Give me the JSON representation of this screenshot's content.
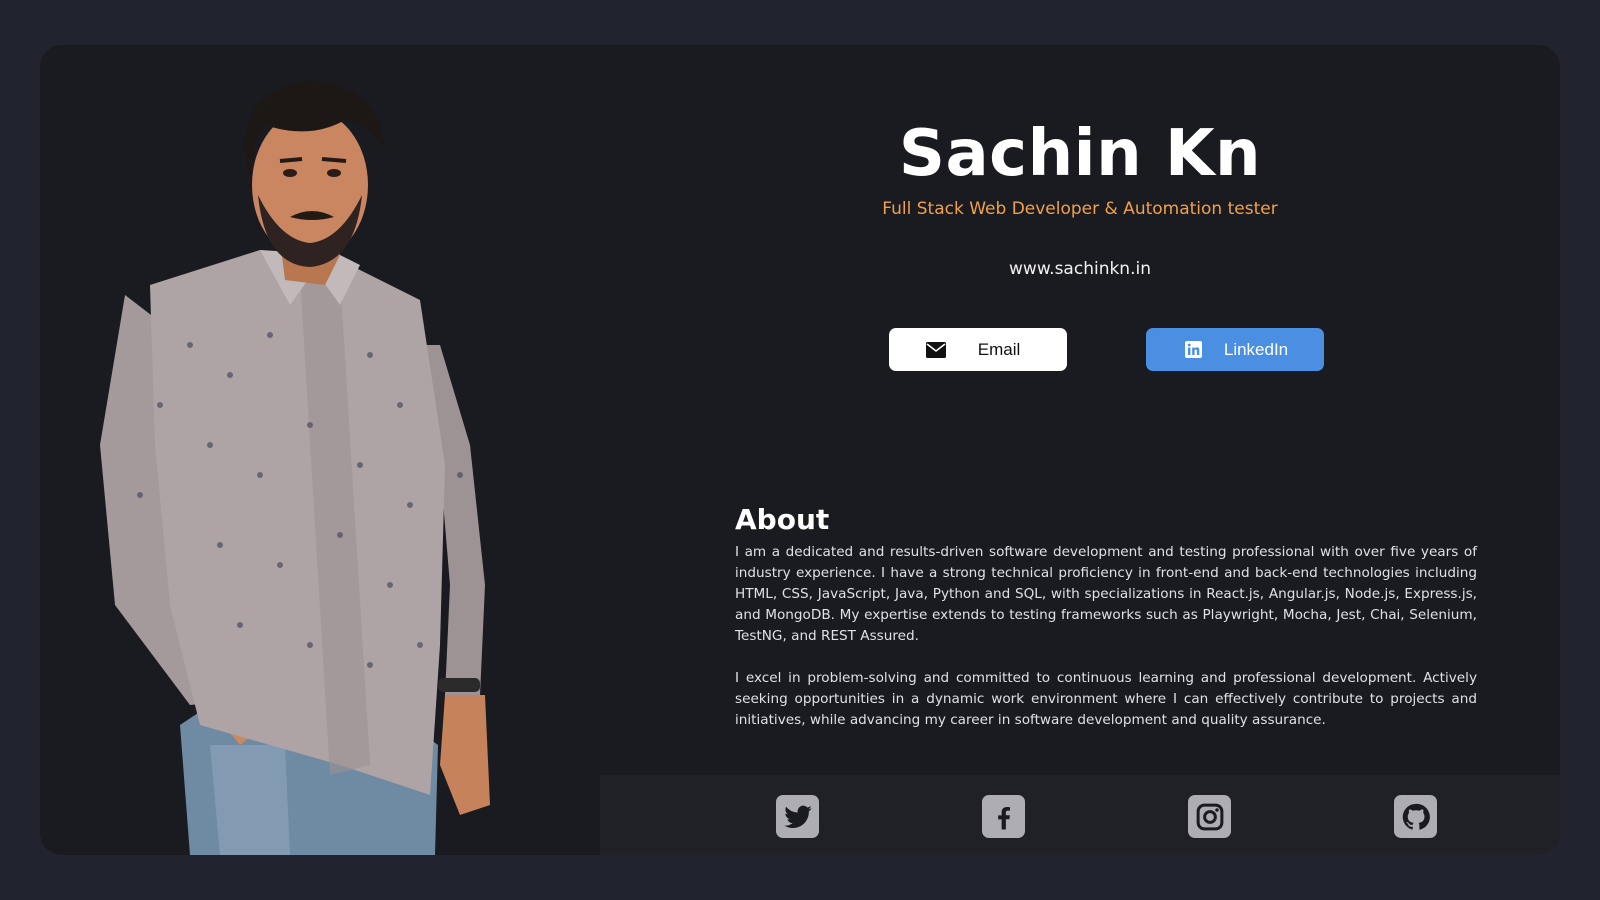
{
  "profile": {
    "name": "Sachin Kn",
    "subtitle": "Full Stack Web Developer & Automation tester",
    "website": "www.sachinkn.in"
  },
  "buttons": {
    "email": {
      "label": "Email",
      "icon": "envelope-icon"
    },
    "linkedin": {
      "label": "LinkedIn",
      "icon": "linkedin-icon"
    }
  },
  "about": {
    "heading": "About",
    "paragraphs": [
      "I am a dedicated and results-driven software development and testing professional with over five years of industry experience. I have a strong technical proficiency in front-end and back-end technologies including HTML, CSS, JavaScript, Java, Python and SQL, with specializations in React.js, Angular.js, Node.js, Express.js, and MongoDB. My expertise extends to testing frameworks such as Playwright, Mocha, Jest, Chai, Selenium, TestNG, and REST Assured.",
      "I excel in problem-solving and committed to continuous learning and professional development. Actively seeking opportunities in a dynamic work environment where I can effectively contribute to projects and initiatives, while advancing my career in software development and quality assurance."
    ]
  },
  "social": [
    {
      "icon": "twitter-icon"
    },
    {
      "icon": "facebook-icon"
    },
    {
      "icon": "instagram-icon"
    },
    {
      "icon": "github-icon"
    }
  ],
  "colors": {
    "page_background": "#21242e",
    "card_background": "#1a1b20",
    "accent_orange": "#f0a14a",
    "linkedin_blue": "#4a8fe2",
    "social_icon_bg": "#adadb3"
  }
}
